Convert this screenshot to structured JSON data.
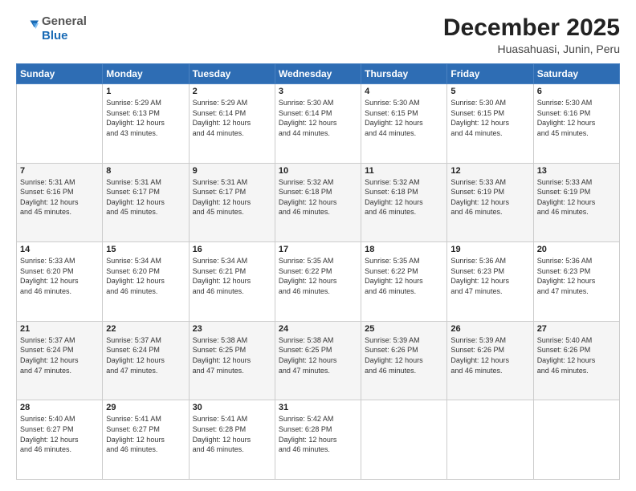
{
  "header": {
    "logo": {
      "line1": "General",
      "line2": "Blue"
    },
    "title": "December 2025",
    "subtitle": "Huasahuasi, Junin, Peru"
  },
  "calendar": {
    "days_of_week": [
      "Sunday",
      "Monday",
      "Tuesday",
      "Wednesday",
      "Thursday",
      "Friday",
      "Saturday"
    ],
    "weeks": [
      [
        {
          "day": "",
          "info": ""
        },
        {
          "day": "1",
          "info": "Sunrise: 5:29 AM\nSunset: 6:13 PM\nDaylight: 12 hours\nand 43 minutes."
        },
        {
          "day": "2",
          "info": "Sunrise: 5:29 AM\nSunset: 6:14 PM\nDaylight: 12 hours\nand 44 minutes."
        },
        {
          "day": "3",
          "info": "Sunrise: 5:30 AM\nSunset: 6:14 PM\nDaylight: 12 hours\nand 44 minutes."
        },
        {
          "day": "4",
          "info": "Sunrise: 5:30 AM\nSunset: 6:15 PM\nDaylight: 12 hours\nand 44 minutes."
        },
        {
          "day": "5",
          "info": "Sunrise: 5:30 AM\nSunset: 6:15 PM\nDaylight: 12 hours\nand 44 minutes."
        },
        {
          "day": "6",
          "info": "Sunrise: 5:30 AM\nSunset: 6:16 PM\nDaylight: 12 hours\nand 45 minutes."
        }
      ],
      [
        {
          "day": "7",
          "info": "Sunrise: 5:31 AM\nSunset: 6:16 PM\nDaylight: 12 hours\nand 45 minutes."
        },
        {
          "day": "8",
          "info": "Sunrise: 5:31 AM\nSunset: 6:17 PM\nDaylight: 12 hours\nand 45 minutes."
        },
        {
          "day": "9",
          "info": "Sunrise: 5:31 AM\nSunset: 6:17 PM\nDaylight: 12 hours\nand 45 minutes."
        },
        {
          "day": "10",
          "info": "Sunrise: 5:32 AM\nSunset: 6:18 PM\nDaylight: 12 hours\nand 46 minutes."
        },
        {
          "day": "11",
          "info": "Sunrise: 5:32 AM\nSunset: 6:18 PM\nDaylight: 12 hours\nand 46 minutes."
        },
        {
          "day": "12",
          "info": "Sunrise: 5:33 AM\nSunset: 6:19 PM\nDaylight: 12 hours\nand 46 minutes."
        },
        {
          "day": "13",
          "info": "Sunrise: 5:33 AM\nSunset: 6:19 PM\nDaylight: 12 hours\nand 46 minutes."
        }
      ],
      [
        {
          "day": "14",
          "info": "Sunrise: 5:33 AM\nSunset: 6:20 PM\nDaylight: 12 hours\nand 46 minutes."
        },
        {
          "day": "15",
          "info": "Sunrise: 5:34 AM\nSunset: 6:20 PM\nDaylight: 12 hours\nand 46 minutes."
        },
        {
          "day": "16",
          "info": "Sunrise: 5:34 AM\nSunset: 6:21 PM\nDaylight: 12 hours\nand 46 minutes."
        },
        {
          "day": "17",
          "info": "Sunrise: 5:35 AM\nSunset: 6:22 PM\nDaylight: 12 hours\nand 46 minutes."
        },
        {
          "day": "18",
          "info": "Sunrise: 5:35 AM\nSunset: 6:22 PM\nDaylight: 12 hours\nand 46 minutes."
        },
        {
          "day": "19",
          "info": "Sunrise: 5:36 AM\nSunset: 6:23 PM\nDaylight: 12 hours\nand 47 minutes."
        },
        {
          "day": "20",
          "info": "Sunrise: 5:36 AM\nSunset: 6:23 PM\nDaylight: 12 hours\nand 47 minutes."
        }
      ],
      [
        {
          "day": "21",
          "info": "Sunrise: 5:37 AM\nSunset: 6:24 PM\nDaylight: 12 hours\nand 47 minutes."
        },
        {
          "day": "22",
          "info": "Sunrise: 5:37 AM\nSunset: 6:24 PM\nDaylight: 12 hours\nand 47 minutes."
        },
        {
          "day": "23",
          "info": "Sunrise: 5:38 AM\nSunset: 6:25 PM\nDaylight: 12 hours\nand 47 minutes."
        },
        {
          "day": "24",
          "info": "Sunrise: 5:38 AM\nSunset: 6:25 PM\nDaylight: 12 hours\nand 47 minutes."
        },
        {
          "day": "25",
          "info": "Sunrise: 5:39 AM\nSunset: 6:26 PM\nDaylight: 12 hours\nand 46 minutes."
        },
        {
          "day": "26",
          "info": "Sunrise: 5:39 AM\nSunset: 6:26 PM\nDaylight: 12 hours\nand 46 minutes."
        },
        {
          "day": "27",
          "info": "Sunrise: 5:40 AM\nSunset: 6:26 PM\nDaylight: 12 hours\nand 46 minutes."
        }
      ],
      [
        {
          "day": "28",
          "info": "Sunrise: 5:40 AM\nSunset: 6:27 PM\nDaylight: 12 hours\nand 46 minutes."
        },
        {
          "day": "29",
          "info": "Sunrise: 5:41 AM\nSunset: 6:27 PM\nDaylight: 12 hours\nand 46 minutes."
        },
        {
          "day": "30",
          "info": "Sunrise: 5:41 AM\nSunset: 6:28 PM\nDaylight: 12 hours\nand 46 minutes."
        },
        {
          "day": "31",
          "info": "Sunrise: 5:42 AM\nSunset: 6:28 PM\nDaylight: 12 hours\nand 46 minutes."
        },
        {
          "day": "",
          "info": ""
        },
        {
          "day": "",
          "info": ""
        },
        {
          "day": "",
          "info": ""
        }
      ]
    ]
  }
}
